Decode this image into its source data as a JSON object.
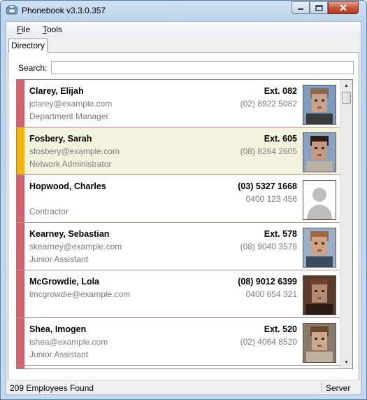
{
  "window": {
    "title": "Phonebook v3.3.0.357"
  },
  "menu": {
    "file": "File",
    "tools": "Tools"
  },
  "tabs": [
    "Directory"
  ],
  "search": {
    "label": "Search:",
    "value": ""
  },
  "colors": {
    "strip": "#d4636d",
    "selected_strip": "#f6b40e",
    "selected_bg": "#f2f3dc"
  },
  "employees": [
    {
      "name": "Clarey, Elijah",
      "line2": "jclarey@example.com",
      "line3": "Department Manager",
      "primary": "Ext. 082",
      "secondary": "(02) 8922 5082",
      "photo": "male-photo-1",
      "selected": false
    },
    {
      "name": "Fosbery, Sarah",
      "line2": "sfosbery@example.com",
      "line3": "Network Administrator",
      "primary": "Ext. 605",
      "secondary": "(08) 8264 2605",
      "photo": "female-photo-1",
      "selected": true
    },
    {
      "name": "Hopwood, Charles",
      "line2": "",
      "line3": "Contractor",
      "primary": "(03) 5327 1668",
      "secondary": "0400 123 456",
      "photo": "default-avatar",
      "selected": false
    },
    {
      "name": "Kearney, Sebastian",
      "line2": "skearney@example.com",
      "line3": "Junior Assistant",
      "primary": "Ext. 578",
      "secondary": "(08) 9040 3578",
      "photo": "male-photo-2",
      "selected": false
    },
    {
      "name": "McGrowdie, Lola",
      "line2": "lmcgrowdie@example.com",
      "line3": "",
      "primary": "(08) 9012 6399",
      "secondary": "0400 654 321",
      "photo": "female-photo-2",
      "selected": false
    },
    {
      "name": "Shea, Imogen",
      "line2": "ishea@example.com",
      "line3": "Junior Assistant",
      "primary": "Ext. 520",
      "secondary": "(02) 4064 8520",
      "photo": "female-photo-3",
      "selected": false
    }
  ],
  "status": {
    "count": "209 Employees Found",
    "source": "Server"
  }
}
